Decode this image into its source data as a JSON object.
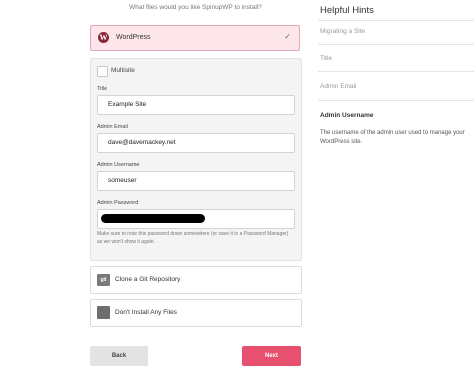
{
  "installer": {
    "question": "What files would you like SpinupWP to install?",
    "wordpress_option": {
      "label": "WordPress",
      "logo_letter": "W",
      "selected": true
    },
    "form": {
      "multisite_label": "Multisite",
      "multisite_checked": false,
      "title_label": "Title",
      "title_value": "Example Site",
      "admin_email_label": "Admin Email",
      "admin_email_value": "dave@davemackey.net",
      "admin_username_label": "Admin Username",
      "admin_username_value": "someuser",
      "admin_password_label": "Admin Password",
      "password_note": "Make sure to note this password down somewhere (or save it in a Password Manager) as we won't show it again."
    },
    "git_option": {
      "label": "Clone a Git Repository",
      "icon_text": "git"
    },
    "no_files_option": {
      "label": "Don't Install Any Files"
    },
    "buttons": {
      "back": "Back",
      "next": "Next"
    }
  },
  "hints": {
    "title": "Helpful Hints",
    "items": [
      {
        "label": "Migrating a Site"
      },
      {
        "label": "Title"
      },
      {
        "label": "Admin Email"
      },
      {
        "label": "Admin Username",
        "active": true
      }
    ],
    "active_description": "The username of the admin user used to manage your WordPress site."
  },
  "colors": {
    "accent": "#e8506f",
    "selected_bg": "#fde6ea",
    "wp_logo": "#8a2437"
  }
}
